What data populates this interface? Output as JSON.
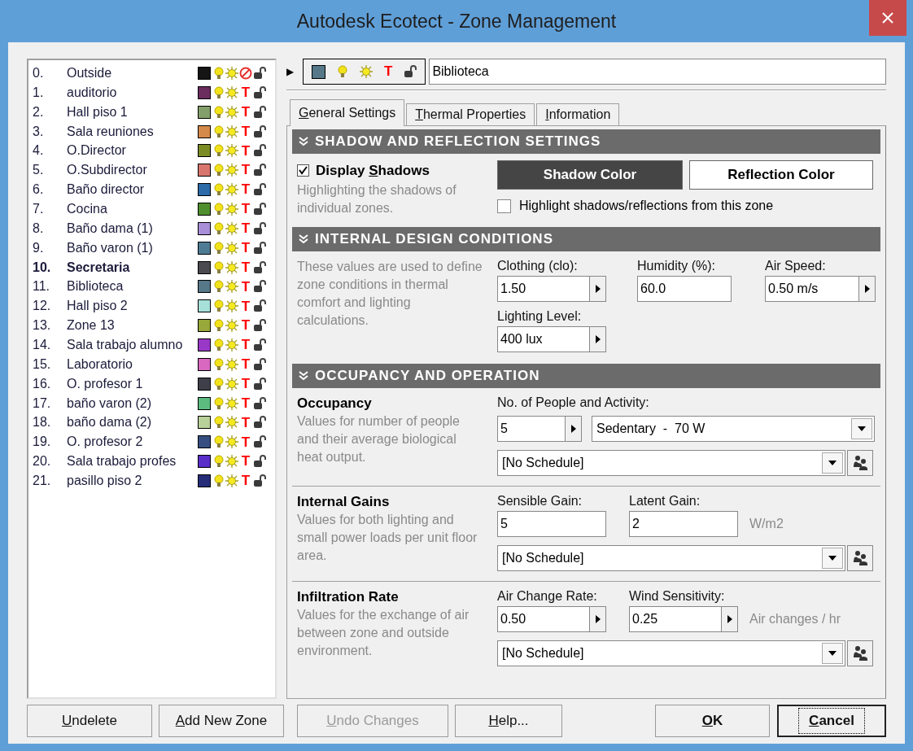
{
  "window": {
    "title": "Autodesk Ecotect - Zone Management"
  },
  "zones": [
    {
      "number": "0.",
      "name": "Outside",
      "color": "#151515",
      "current": false
    },
    {
      "number": "1.",
      "name": "auditorio",
      "color": "#6b2d5e",
      "current": false,
      "t": "T"
    },
    {
      "number": "2.",
      "name": "Hall piso 1",
      "color": "#84a06a",
      "current": false,
      "t": "T"
    },
    {
      "number": "3.",
      "name": "Sala reuniones",
      "color": "#d48a4a",
      "current": false,
      "t": "T"
    },
    {
      "number": "4.",
      "name": "O.Director",
      "color": "#7a8c23",
      "current": false,
      "t": "T"
    },
    {
      "number": "5.",
      "name": "O.Subdirector",
      "color": "#d8766e",
      "current": false,
      "t": "T"
    },
    {
      "number": "6.",
      "name": "Baño director",
      "color": "#2c6aa8",
      "current": false,
      "t": "T"
    },
    {
      "number": "7.",
      "name": "Cocina",
      "color": "#4f8f2e",
      "current": false,
      "t": "T"
    },
    {
      "number": "8.",
      "name": "Baño dama (1)",
      "color": "#a98fd8",
      "current": false,
      "t": "T"
    },
    {
      "number": "9.",
      "name": "Baño varon (1)",
      "color": "#4f7c94",
      "current": false,
      "t": "T"
    },
    {
      "number": "10.",
      "name": "Secretaria",
      "color": "#4a4a50",
      "current": true,
      "t": "T"
    },
    {
      "number": "11.",
      "name": "Biblioteca",
      "color": "#567888",
      "current": false,
      "t": "T"
    },
    {
      "number": "12.",
      "name": "Hall piso 2",
      "color": "#a6e0d8",
      "current": false,
      "t": "T"
    },
    {
      "number": "13.",
      "name": "Zone 13",
      "color": "#98a83a",
      "current": false,
      "t": "T"
    },
    {
      "number": "14.",
      "name": "Sala trabajo alumno",
      "color": "#9a38c8",
      "current": false,
      "t": "T"
    },
    {
      "number": "15.",
      "name": "Laboratorio",
      "color": "#d868c0",
      "current": false,
      "t": "T"
    },
    {
      "number": "16.",
      "name": "O. profesor 1",
      "color": "#3f3f4a",
      "current": false,
      "t": "T"
    },
    {
      "number": "17.",
      "name": "baño varon (2)",
      "color": "#5cbc80",
      "current": false,
      "t": "T"
    },
    {
      "number": "18.",
      "name": "baño dama (2)",
      "color": "#b8d09a",
      "current": false,
      "t": "T"
    },
    {
      "number": "19.",
      "name": "O. profesor 2",
      "color": "#364f80",
      "current": false,
      "t": "T"
    },
    {
      "number": "20.",
      "name": "Sala trabajo profes",
      "color": "#5a2ec8",
      "current": false,
      "t": "T"
    },
    {
      "number": "21.",
      "name": "pasillo piso 2",
      "color": "#252c78",
      "current": false,
      "t": "T"
    }
  ],
  "selected_zone": {
    "arrow": "▶",
    "color": "#567888",
    "t": "T",
    "name": "Biblioteca"
  },
  "tabs": [
    {
      "label": "General Settings",
      "selected": true
    },
    {
      "label": "Thermal Properties",
      "selected": false
    },
    {
      "label": "Information",
      "selected": false
    }
  ],
  "shadow": {
    "title": "SHADOW AND REFLECTION SETTINGS",
    "display": {
      "label": "Display Shadows",
      "checked": true
    },
    "description": "Highlighting the shadows of individual zones.",
    "shadow_button": "Shadow Color",
    "reflection_button": "Reflection Color",
    "highlight": {
      "label": "Highlight shadows/reflections from this zone",
      "checked": false
    }
  },
  "design": {
    "title": "INTERNAL DESIGN CONDITIONS",
    "description": "These values are used to define zone conditions in thermal comfort and lighting calculations.",
    "clothing": {
      "label": "Clothing (clo):",
      "value": "1.50"
    },
    "humidity": {
      "label": "Humidity (%):",
      "value": "60.0"
    },
    "air_speed": {
      "label": "Air Speed:",
      "value": "0.50 m/s"
    },
    "lighting": {
      "label": "Lighting Level:",
      "value": "400 lux"
    }
  },
  "occupancy": {
    "title": "OCCUPANCY AND OPERATION",
    "occupancy": {
      "heading": "Occupancy",
      "description": "Values for number of people and their average biological heat output.",
      "label": "No. of People and Activity:",
      "people": "5",
      "activity": "Sedentary  -  70 W",
      "schedule": "[No Schedule]"
    },
    "gains": {
      "heading": "Internal Gains",
      "description": "Values for both lighting and small power loads per unit floor area.",
      "sensible": {
        "label": "Sensible Gain:",
        "value": "5"
      },
      "latent": {
        "label": "Latent Gain:",
        "value": "2"
      },
      "unit": "W/m2",
      "schedule": "[No Schedule]"
    },
    "infiltration": {
      "heading": "Infiltration Rate",
      "description": "Values for the exchange of air between zone and outside environment.",
      "air_change": {
        "label": "Air Change Rate:",
        "value": "0.50"
      },
      "wind": {
        "label": "Wind Sensitivity:",
        "value": "0.25"
      },
      "unit": "Air changes / hr",
      "schedule": "[No Schedule]"
    }
  },
  "buttons": [
    {
      "label": "Undelete",
      "disabled": false,
      "default": false,
      "focused": false
    },
    {
      "label": "Add New Zone",
      "disabled": false,
      "default": false,
      "focused": false
    },
    {
      "label": "Undo Changes",
      "disabled": true,
      "default": false,
      "focused": false
    },
    {
      "label": "Help...",
      "disabled": false,
      "default": false,
      "focused": false
    },
    {
      "label": "OK",
      "disabled": false,
      "default": true,
      "focused": false
    },
    {
      "label": "Cancel",
      "disabled": false,
      "default": true,
      "focused": true
    }
  ]
}
